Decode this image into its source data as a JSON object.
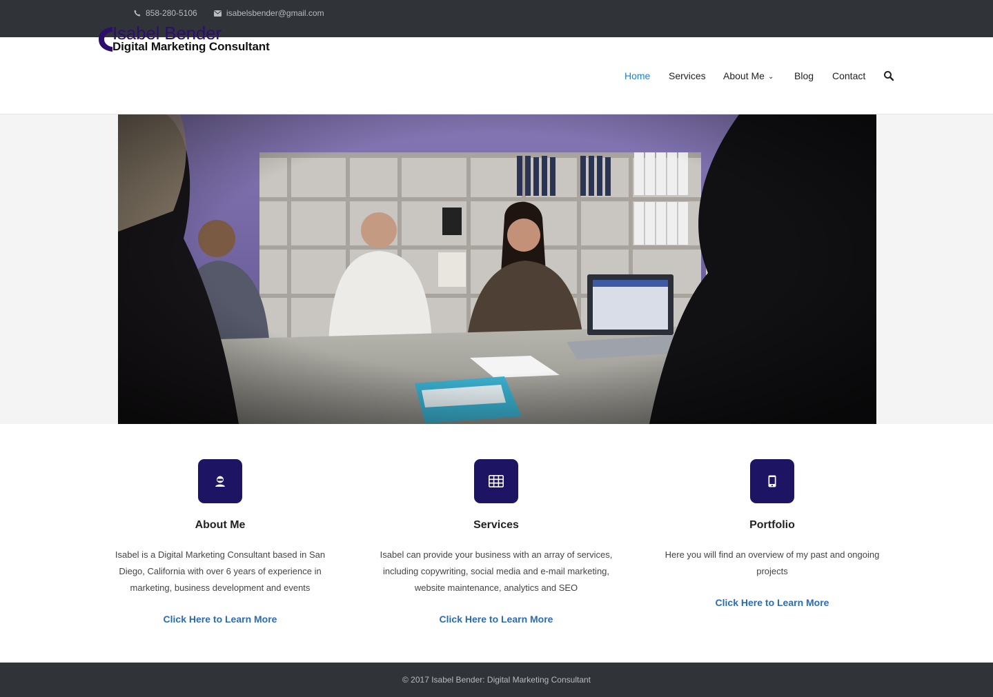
{
  "topbar": {
    "phone": "858-280-5106",
    "email": "isabelsbender@gmail.com",
    "phone_icon": "phone-icon",
    "email_icon": "envelope-icon"
  },
  "logo": {
    "name": "Isabel Bender",
    "tagline": "Digital Marketing Consultant"
  },
  "nav": {
    "items": [
      {
        "label": "Home",
        "active": true
      },
      {
        "label": "Services"
      },
      {
        "label": "About Me",
        "has_dropdown": true
      },
      {
        "label": "Blog"
      },
      {
        "label": "Contact"
      }
    ],
    "search_icon": "search-icon"
  },
  "hero": {
    "image": "office meeting photo"
  },
  "features": [
    {
      "icon": "user-icon",
      "title": "About Me",
      "text_lines": [
        "Isabel is a Digital Marketing Consultant based in San",
        "Diego, California with over 6 years of experience in",
        "marketing, business development and events"
      ],
      "link": "Click Here to Learn More"
    },
    {
      "icon": "table-icon",
      "title": "Services",
      "text_lines": [
        "Isabel can provide your business with an array of services,",
        "including copywriting, social media and e-mail marketing,",
        "website maintenance, analytics and SEO"
      ],
      "link": "Click Here to Learn More"
    },
    {
      "icon": "mobile-icon",
      "title": "Portfolio",
      "text_lines": [
        "Here you will find an overview of my past and ongoing",
        "projects"
      ],
      "link": "Click Here to Learn More"
    }
  ],
  "footer": {
    "copyright": "© 2017 Isabel Bender: Digital Marketing Consultant"
  },
  "colors": {
    "topbar_bg": "#303338",
    "accent_nav": "#1e7fcf",
    "icon_box": "#1d1463",
    "link": "#2a6bb6",
    "logo_purple": "#2b0f6b"
  }
}
